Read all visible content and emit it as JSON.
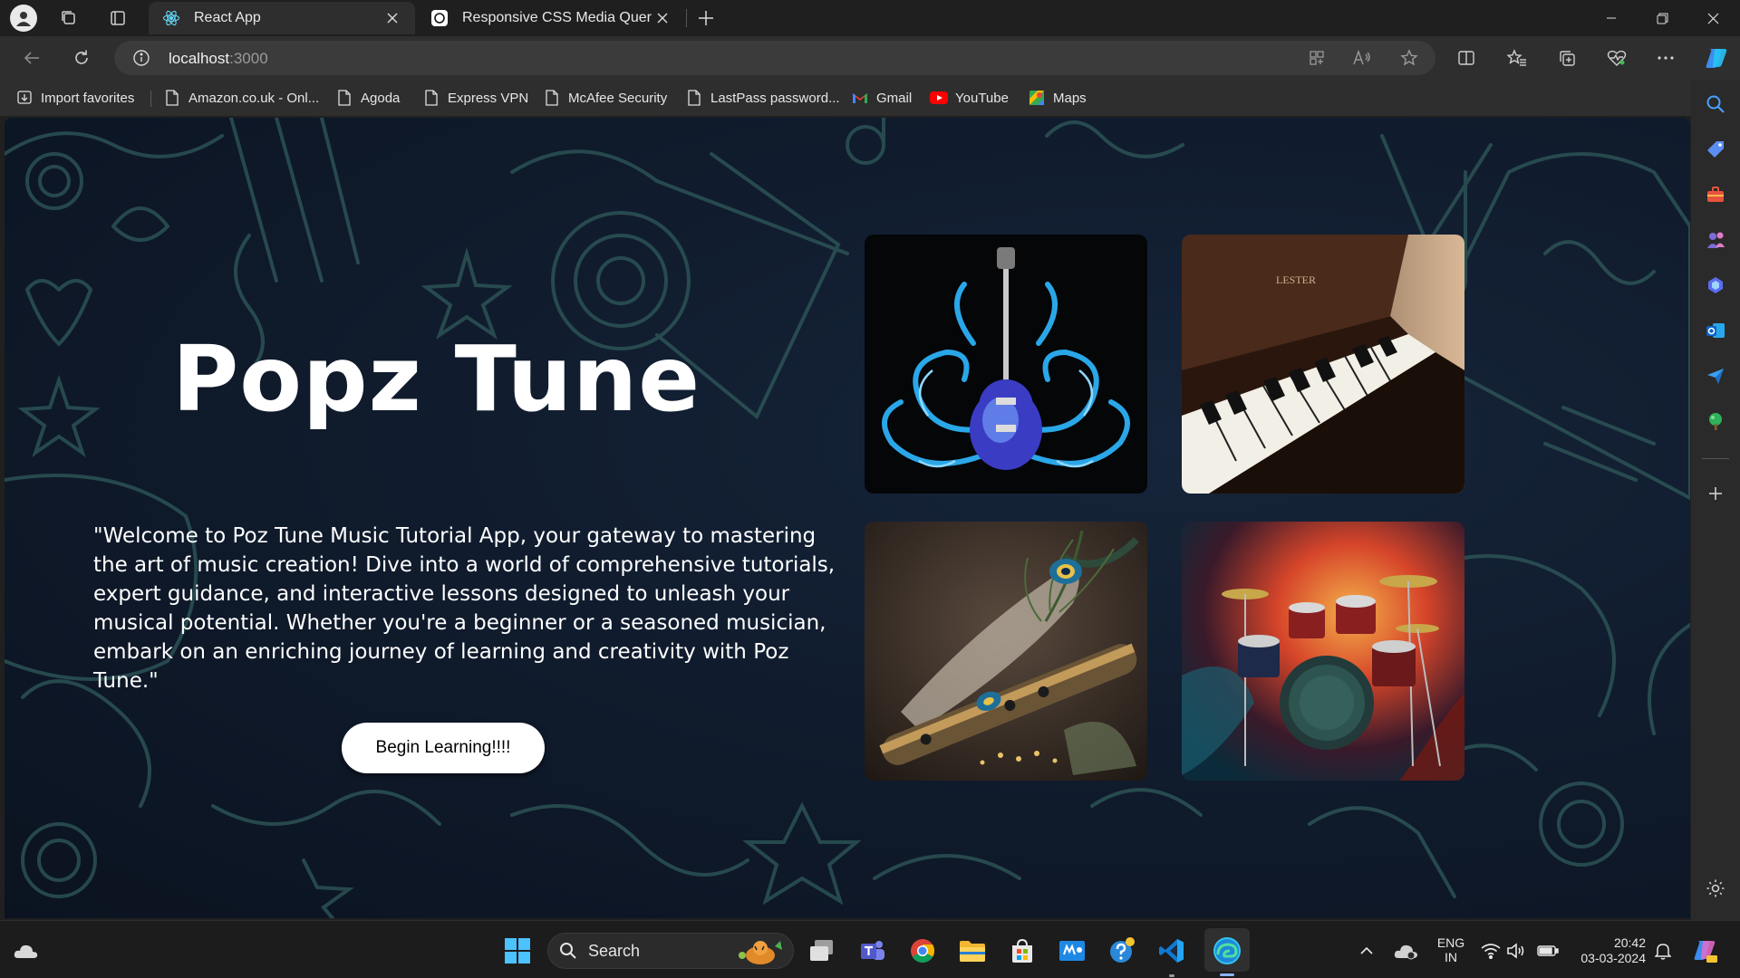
{
  "browser": {
    "tabs": [
      {
        "title": "React App",
        "active": true
      },
      {
        "title": "Responsive CSS Media Queries.",
        "active": false
      }
    ],
    "address": {
      "host": "localhost",
      "port": ":3000"
    },
    "favorites": [
      {
        "label": "Import favorites",
        "icon": "import-icon"
      },
      {
        "label": "Amazon.co.uk - Onl...",
        "icon": "page-icon"
      },
      {
        "label": "Agoda",
        "icon": "page-icon"
      },
      {
        "label": "Express VPN",
        "icon": "page-icon"
      },
      {
        "label": "McAfee Security",
        "icon": "page-icon"
      },
      {
        "label": "LastPass password...",
        "icon": "page-icon"
      },
      {
        "label": "Gmail",
        "icon": "gmail-icon"
      },
      {
        "label": "YouTube",
        "icon": "youtube-icon"
      },
      {
        "label": "Maps",
        "icon": "maps-icon"
      }
    ]
  },
  "page": {
    "title": "Popz Tune",
    "description": "\"Welcome to Poz Tune Music Tutorial App, your gateway to mastering the art of music creation! Dive into a world of comprehensive tutorials, expert guidance, and interactive lessons designed to unleash your musical potential. Whether you're a beginner or a seasoned musician, embark on an enriching journey of learning and creativity with Poz Tune.\"",
    "cta_label": "Begin Learning!!!!",
    "images": [
      {
        "subject": "guitar",
        "icon": "guitar-image"
      },
      {
        "subject": "piano",
        "icon": "piano-image",
        "brand_text": "LESTER"
      },
      {
        "subject": "flute",
        "icon": "flute-image"
      },
      {
        "subject": "drums",
        "icon": "drums-image"
      }
    ],
    "colors": {
      "background": "#0f1a2b",
      "doodle": "#2f5a5a",
      "button_bg": "#ffffff"
    }
  },
  "taskbar": {
    "search_label": "Search",
    "language_line1": "ENG",
    "language_line2": "IN",
    "time": "20:42",
    "date": "03-03-2024"
  }
}
